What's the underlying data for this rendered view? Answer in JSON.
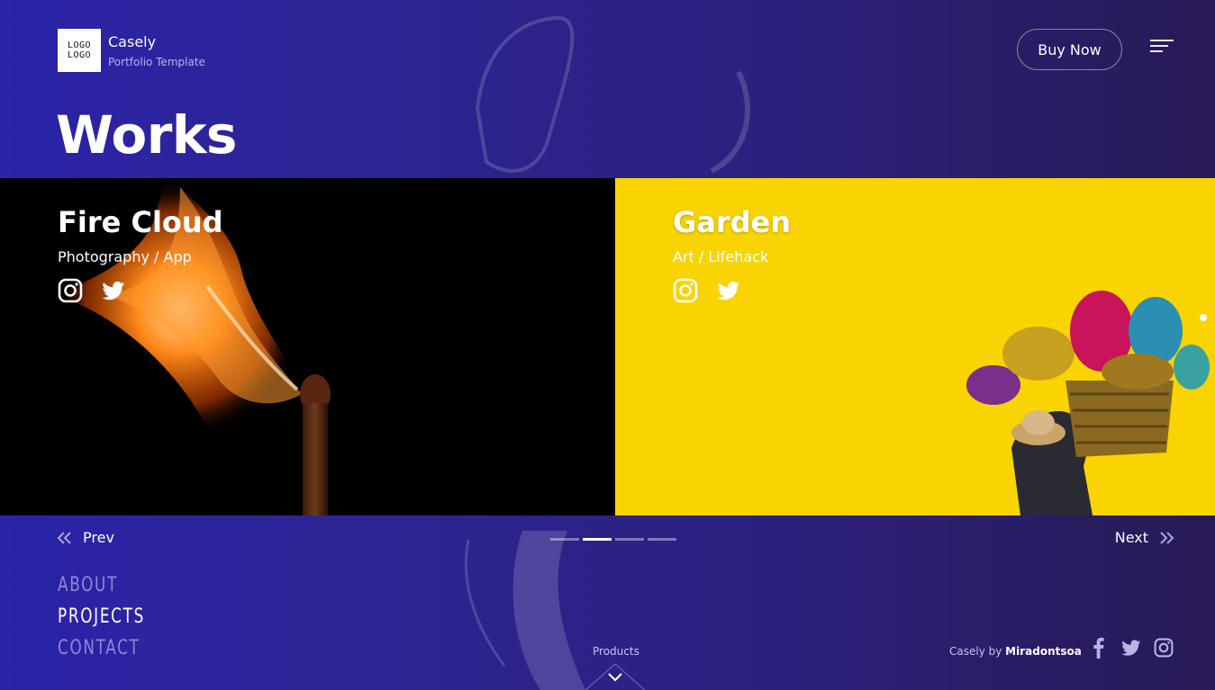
{
  "header": {
    "logo_text": [
      "LOGO",
      "LOGO"
    ],
    "brand_name": "Casely",
    "brand_subtitle": "Portfolio Template",
    "buy_button": "Buy Now",
    "menu_icon": "hamburger-menu-icon"
  },
  "page": {
    "title": "Works"
  },
  "works": [
    {
      "title": "Fire Cloud",
      "category": "Photography / App",
      "icons": [
        "instagram-icon",
        "twitter-icon"
      ],
      "background": "#000000"
    },
    {
      "title": "Garden",
      "category": "Art / Lifehack",
      "icons": [
        "instagram-icon",
        "twitter-icon"
      ],
      "background": "#f9d400"
    }
  ],
  "slider": {
    "prev_label": "Prev",
    "next_label": "Next",
    "page_count": 4,
    "active_index": 1
  },
  "nav": [
    {
      "label": "ABOUT",
      "current": false
    },
    {
      "label": "PROJECTS",
      "current": true
    },
    {
      "label": "CONTACT",
      "current": false
    }
  ],
  "footer": {
    "products_label": "Products",
    "credit_prefix": "Casely by",
    "credit_author": "Miradontsoa",
    "social_icons": [
      "facebook-icon",
      "twitter-icon",
      "instagram-icon"
    ]
  },
  "colors": {
    "accent": "#2b23a8",
    "yellow": "#f9d400",
    "dark": "#281a55"
  }
}
